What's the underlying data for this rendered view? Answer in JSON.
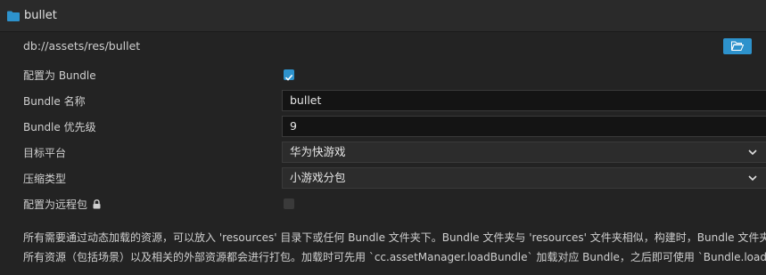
{
  "header": {
    "title": "bullet",
    "icon": "folder-icon"
  },
  "path": {
    "value": "db://assets/res/bullet",
    "open_icon": "folder-open-icon"
  },
  "props": {
    "bundle_config": {
      "label": "配置为 Bundle",
      "checked": true
    },
    "bundle_name": {
      "label": "Bundle 名称",
      "value": "bullet"
    },
    "bundle_priority": {
      "label": "Bundle 优先级",
      "value": "9"
    },
    "target_platform": {
      "label": "目标平台",
      "value": "华为快游戏"
    },
    "compression_type": {
      "label": "压缩类型",
      "value": "小游戏分包"
    },
    "remote_bundle": {
      "label": "配置为远程包",
      "checked": false,
      "lock_icon": "lock-icon"
    }
  },
  "description": {
    "line1": "所有需要通过动态加载的资源，可以放入 'resources' 目录下或任何 Bundle 文件夹下。Bundle 文件夹与 'resources' 文件夹相似，构建时，Bundle 文件夹内的",
    "line2": "所有资源（包括场景）以及相关的外部资源都会进行打包。加载时可先用 `cc.assetManager.loadBundle` 加载对应 Bundle，之后即可使用 `Bundle.load` 等"
  },
  "colors": {
    "accent": "#2d92cc",
    "background": "#232323"
  }
}
